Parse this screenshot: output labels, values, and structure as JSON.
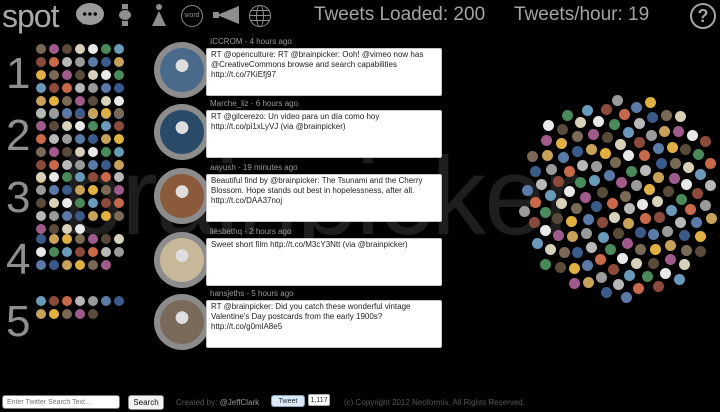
{
  "header": {
    "logo_text": "spot",
    "nav_icons": [
      "speech-bubble-icon",
      "watch-icon",
      "person-icon",
      "word-icon",
      "megaphone-icon",
      "globe-icon"
    ],
    "word_icon_label": "word",
    "tweets_loaded": "Tweets Loaded: 200",
    "tweets_per_hour": "Tweets/hour: 19",
    "help_label": "?"
  },
  "watermark": "brainpicker",
  "ranks": [
    "1",
    "2",
    "3",
    "4",
    "5"
  ],
  "rank_avatar_counts": [
    42,
    36,
    32,
    20,
    12
  ],
  "avatar_palette": [
    "#7a6a55",
    "#c9a25a",
    "#5a7aa8",
    "#b8b8b8",
    "#8c4a3a",
    "#4a8a5a",
    "#d8d0b8",
    "#a05a8c",
    "#e0b040",
    "#3a5a8a",
    "#9a9a9a",
    "#c86a4a",
    "#6a9aba",
    "#e8e8e8",
    "#5a4a3a"
  ],
  "tweets": [
    {
      "user": "ICCROM",
      "time": "4 hours ago",
      "text": "RT @openculture: RT @brainpicker: Ooh! @vimeo now has @CreativeCommons browse and search capabilities http://t.co/7KiEfj97",
      "avatar_color": "#4a6a8c"
    },
    {
      "user": "Marche_liz",
      "time": "6 hours ago",
      "text": "RT @gilcerezo: Un video para un día como hoy http://t.co/pi1xLyVJ (via @brainpicker)",
      "avatar_color": "#2a4a6a"
    },
    {
      "user": "aayush",
      "time": "19 minutes ago",
      "text": "Beautiful find by @brainpicker: The Tsunami and the Cherry Blossom. Hope stands out best in hopelessness, after all. http://t.co/DAA37noj",
      "avatar_color": "#8a5a3a"
    },
    {
      "user": "liesbethq",
      "time": "2 hours ago",
      "text": "Sweet short film http://t.co/M3cY3Ntt (via @brainpicker)",
      "avatar_color": "#c8b89a"
    },
    {
      "user": "hansjeths",
      "time": "5 hours ago",
      "text": "RT @brainpicker: Did you catch these wonderful vintage Valentine's Day postcards from the early 1900s? http://t.co/g0mlA8e5",
      "avatar_color": "#7a6a5a"
    }
  ],
  "cloud_avatar_count": 150,
  "footer": {
    "search_placeholder": "Enter Twitter Search Text...",
    "search_button": "Search",
    "created_by": "Created by:",
    "creator": "@JeffClark",
    "tweet_button": "Tweet",
    "tweet_count": "1,117",
    "copyright": "(c) Copyright 2012 Neoformix. All Rights Reserved."
  }
}
